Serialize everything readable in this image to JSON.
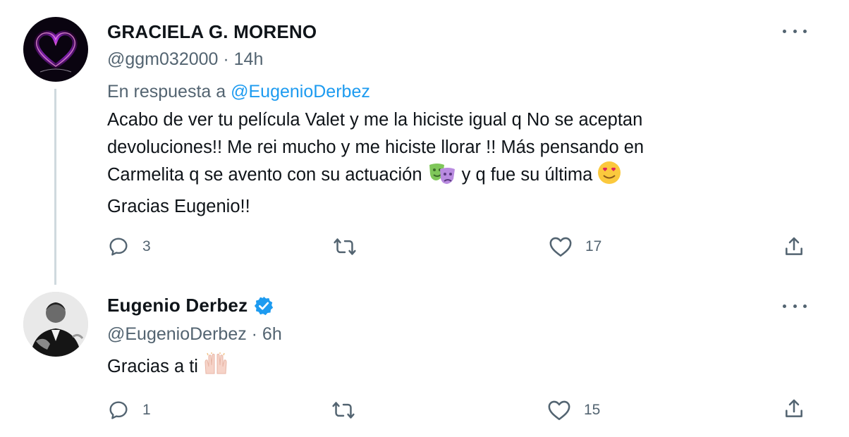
{
  "tweets": [
    {
      "display_name": "GRACIELA G. MORENO",
      "handle_time": "@ggm032000 · 14h",
      "reply_prefix": "En respuesta a ",
      "reply_mention": "@EugenioDerbez",
      "text_lines": [
        "Acabo de ver tu película Valet y me la hiciste  igual q No se aceptan",
        "devoluciones!! Me rei mucho y me hiciste llorar !! Más pensando en",
        "Carmelita q se avento con su actuación ",
        " y q fue su última ",
        "Gracias Eugenio!!"
      ],
      "counts": {
        "reply": "3",
        "retweet": "",
        "like": "17"
      },
      "emojis": [
        "performing-arts-emoji",
        "smiling-face-with-heart-eyes-emoji"
      ]
    },
    {
      "display_name": "Eugenio Derbez",
      "verified": true,
      "handle_time": "@EugenioDerbez · 6h",
      "text": "Gracias a ti ",
      "counts": {
        "reply": "1",
        "retweet": "",
        "like": "15"
      },
      "emojis": [
        "raising-hands-emoji"
      ]
    }
  ],
  "colors": {
    "text": "#0f1419",
    "secondary": "#536471",
    "accent": "#1d9bf0",
    "thread_line": "#cfd9de"
  },
  "icons": [
    "reply-icon",
    "retweet-icon",
    "like-icon",
    "share-icon",
    "more-icon",
    "verified-badge-icon"
  ]
}
